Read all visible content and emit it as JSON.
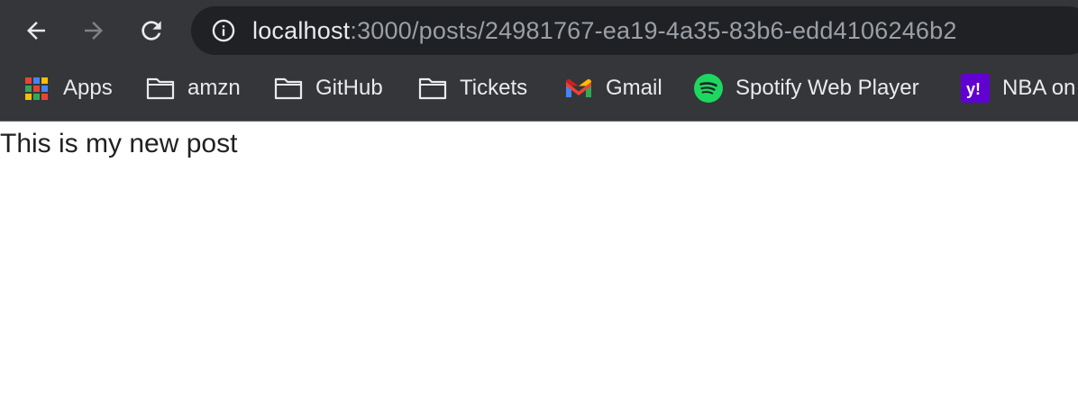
{
  "browser": {
    "address_bar": {
      "host": "localhost",
      "path": ":3000/posts/24981767-ea19-4a35-83b6-edd4106246b2",
      "security_icon": "info-icon"
    },
    "nav": {
      "back_icon": "arrow-left-icon",
      "forward_icon": "arrow-right-icon",
      "reload_icon": "reload-icon"
    },
    "bookmarks": [
      {
        "label": "Apps",
        "icon": "apps-grid-icon"
      },
      {
        "label": "amzn",
        "icon": "folder-icon"
      },
      {
        "label": "GitHub",
        "icon": "folder-icon"
      },
      {
        "label": "Tickets",
        "icon": "folder-icon"
      },
      {
        "label": "Gmail",
        "icon": "gmail-icon"
      },
      {
        "label": "Spotify Web Player",
        "icon": "spotify-icon"
      },
      {
        "label": "NBA on",
        "icon": "yahoo-icon"
      }
    ]
  },
  "page": {
    "post_text": "This is my new post"
  },
  "colors": {
    "chrome_bg": "#35363a",
    "omnibox_bg": "#202124",
    "url_host": "#e8eaed",
    "url_rest": "#9aa0a6",
    "spotify_green": "#1ed760",
    "yahoo_purple": "#6001d2"
  }
}
